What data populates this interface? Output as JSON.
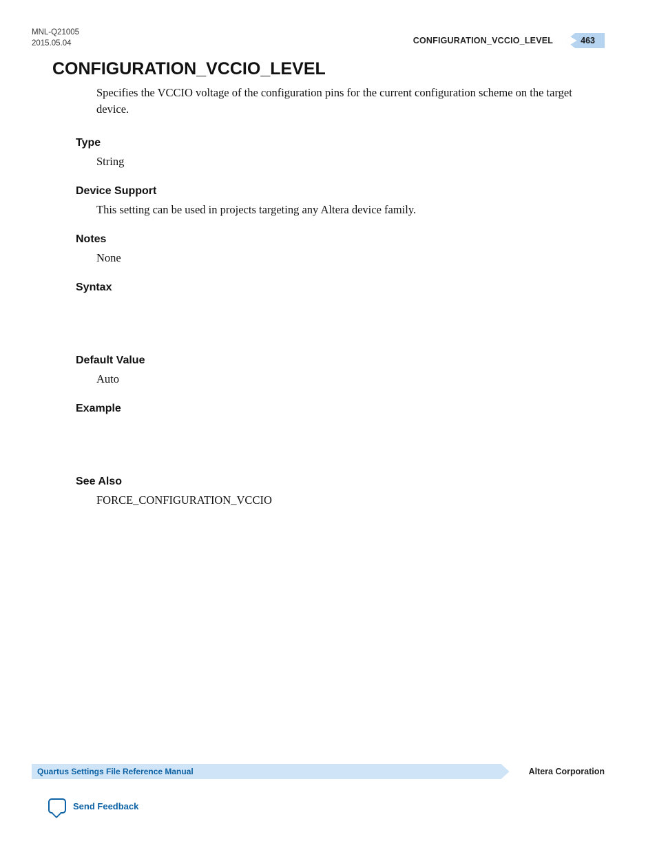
{
  "header": {
    "doc_id": "MNL-Q21005",
    "date": "2015.05.04",
    "running_title": "CONFIGURATION_VCCIO_LEVEL",
    "page_number": "463"
  },
  "title": "CONFIGURATION_VCCIO_LEVEL",
  "intro": "Specifies the VCCIO voltage of the configuration pins for the current configuration scheme on the target device.",
  "sections": {
    "type_h": "Type",
    "type_body": "String",
    "device_h": "Device Support",
    "device_body": "This setting can be used in projects targeting any Altera device family.",
    "notes_h": "Notes",
    "notes_body": "None",
    "syntax_h": "Syntax",
    "default_h": "Default Value",
    "default_body": "Auto",
    "example_h": "Example",
    "seealso_h": "See Also",
    "seealso_body": "FORCE_CONFIGURATION_VCCIO"
  },
  "footer": {
    "manual_title": "Quartus Settings File Reference Manual",
    "company": "Altera Corporation",
    "feedback": "Send Feedback"
  }
}
